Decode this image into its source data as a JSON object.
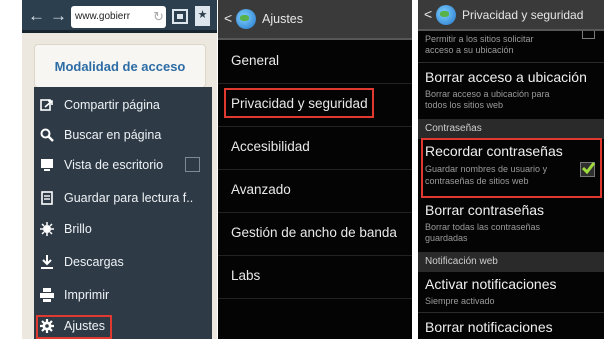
{
  "browser": {
    "url": "www.gobierr",
    "back": "←",
    "forward": "→",
    "reload": "↻",
    "bookmark": "★",
    "site_header": "Modalidad de acceso",
    "menu": [
      {
        "label": "Compartir página",
        "icon": "share-icon"
      },
      {
        "label": "Buscar en página",
        "icon": "search-icon"
      },
      {
        "label": "Vista de escritorio",
        "icon": "desktop-icon"
      },
      {
        "label": "Guardar para lectura f..",
        "icon": "save-offline-icon"
      },
      {
        "label": "Brillo",
        "icon": "brightness-icon"
      },
      {
        "label": "Descargas",
        "icon": "download-icon"
      },
      {
        "label": "Imprimir",
        "icon": "print-icon"
      },
      {
        "label": "Ajustes",
        "icon": "settings-icon"
      }
    ]
  },
  "settings": {
    "title": "Ajustes",
    "back": "<",
    "items": [
      "General",
      "Privacidad y seguridad",
      "Accesibilidad",
      "Avanzado",
      "Gestión de ancho de banda",
      "Labs"
    ]
  },
  "privacy": {
    "title": "Privacidad y seguridad",
    "back": "<",
    "top_sub_1": "Permitir a los sitios solicitar",
    "top_sub_2": "acceso a su ubicación",
    "clear_location": {
      "title": "Borrar acceso a ubicación",
      "sub1": "Borrar acceso a ubicación para",
      "sub2": "todos los sitios web"
    },
    "section_passwords": "Contraseñas",
    "remember_passwords": {
      "title": "Recordar contraseñas",
      "sub1": "Guardar nombres de usuario y",
      "sub2": "contraseñas de sitios web",
      "checked": true
    },
    "clear_passwords": {
      "title": "Borrar contraseñas",
      "sub1": "Borrar todas las contraseñas",
      "sub2": "guardadas"
    },
    "section_notifications": "Notificación web",
    "enable_notifications": {
      "title": "Activar notificaciones",
      "sub": "Siempre activado"
    },
    "clear_notifications": {
      "title": "Borrar notificaciones"
    }
  },
  "colors": {
    "highlight": "#e0392f",
    "check": "#9fdc3c",
    "menu_bg": "#2e3b47",
    "browser_bar": "#2c3f4e"
  }
}
